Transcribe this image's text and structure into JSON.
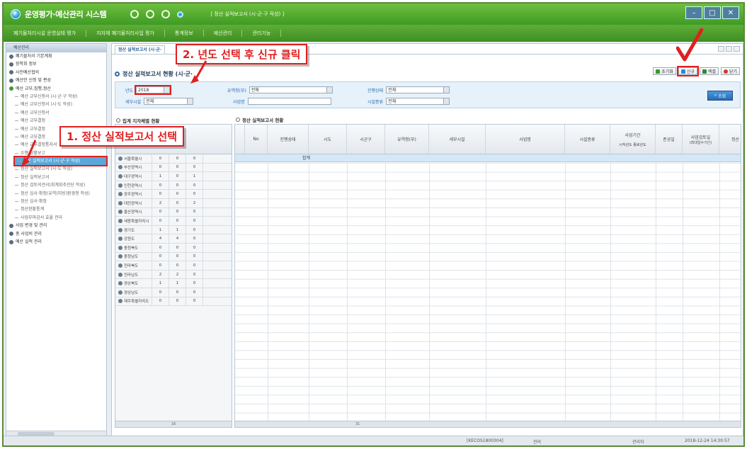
{
  "window": {
    "app_title": "운영평가·예산관리 시스템",
    "doc_title": "[ 정산 실적보고서 (시·군·구 작성) ]"
  },
  "menu": [
    "폐기물처리시설 운영실태 평가",
    "지자체 폐기물처리사업 평가",
    "통계정보",
    "예산관리",
    "관리기능"
  ],
  "sidebar": {
    "header": "예산관리",
    "items": [
      {
        "label": "폐기물처리 기본계획",
        "type": "top"
      },
      {
        "label": "장학회 정보",
        "type": "top"
      },
      {
        "label": "사전예산협의",
        "type": "top"
      },
      {
        "label": "예산안 신청 및 편성",
        "type": "top"
      },
      {
        "label": "예산 교부,집행,정산",
        "type": "top-open"
      },
      {
        "label": "예산 교부신청서 (시·군·구 작성)",
        "type": "child"
      },
      {
        "label": "예산 교부신청서 (시·도 작성)",
        "type": "child"
      },
      {
        "label": "예산 교부신청서",
        "type": "child"
      },
      {
        "label": "예산 교부결정",
        "type": "child"
      },
      {
        "label": "예산 교부결정",
        "type": "child"
      },
      {
        "label": "예산 교부결정",
        "type": "child"
      },
      {
        "label": "예산 교부결정통지서",
        "type": "child"
      },
      {
        "label": "수행 상황보고",
        "type": "child"
      },
      {
        "label": "정산 실적보고서 (시·군·구 작성)",
        "type": "selected"
      },
      {
        "label": "정산 실적보고서 (시·도 작성)",
        "type": "child"
      },
      {
        "label": "정산 실적보고서",
        "type": "child"
      },
      {
        "label": "정산 검토의견서(회계회추진단 작성)",
        "type": "child"
      },
      {
        "label": "정산 심사·확정(유역(지방)환경청 작성)",
        "type": "child"
      },
      {
        "label": "정산 심사·확정",
        "type": "child"
      },
      {
        "label": "정산현황통계",
        "type": "child"
      },
      {
        "label": "사업부마감서 효율 관리",
        "type": "child"
      },
      {
        "label": "사업 변경 및 관리",
        "type": "top"
      },
      {
        "label": "총 사업비 관리",
        "type": "top"
      },
      {
        "label": "예산 실적 관리",
        "type": "top"
      }
    ]
  },
  "main": {
    "tab_label": "정산 실적보고서 (시·군·",
    "page_title": "정산 실적보고서 현황 (시·군·",
    "buttons": {
      "reset": "초기화",
      "new": "신규",
      "excel": "엑셀",
      "close": "닫기"
    },
    "filters": {
      "year_label": "년도",
      "year_value": "2018",
      "office_label": "유역청(부)",
      "office_value": "전체",
      "status_label": "진행상태",
      "status_value": "전체",
      "facility_label": "세부시설",
      "facility_value": "전체",
      "project_label": "사업명",
      "project_value": "",
      "type_label": "시설종류",
      "type_value": "전체",
      "search_button": "조회"
    },
    "left_section_title": "집계 지자체별 현황",
    "right_section_title": "정산 실적보고서 현황",
    "regions": [
      {
        "name": "서울특별시",
        "a": "0",
        "b": "0",
        "c": "0"
      },
      {
        "name": "부산광역시",
        "a": "0",
        "b": "0",
        "c": "0"
      },
      {
        "name": "대구광역시",
        "a": "1",
        "b": "0",
        "c": "1"
      },
      {
        "name": "인천광역시",
        "a": "0",
        "b": "0",
        "c": "0"
      },
      {
        "name": "광주광역시",
        "a": "0",
        "b": "0",
        "c": "0"
      },
      {
        "name": "대전광역시",
        "a": "2",
        "b": "0",
        "c": "2"
      },
      {
        "name": "울산광역시",
        "a": "0",
        "b": "0",
        "c": "0"
      },
      {
        "name": "세종특별자치시",
        "a": "0",
        "b": "0",
        "c": "0"
      },
      {
        "name": "경기도",
        "a": "1",
        "b": "1",
        "c": "0"
      },
      {
        "name": "강원도",
        "a": "4",
        "b": "4",
        "c": "0"
      },
      {
        "name": "충청북도",
        "a": "0",
        "b": "0",
        "c": "0"
      },
      {
        "name": "충청남도",
        "a": "0",
        "b": "0",
        "c": "0"
      },
      {
        "name": "전라북도",
        "a": "0",
        "b": "0",
        "c": "0"
      },
      {
        "name": "전라남도",
        "a": "2",
        "b": "2",
        "c": "0"
      },
      {
        "name": "경상북도",
        "a": "1",
        "b": "1",
        "c": "0"
      },
      {
        "name": "경상남도",
        "a": "0",
        "b": "0",
        "c": "0"
      },
      {
        "name": "제주특별자치도",
        "a": "0",
        "b": "0",
        "c": "0"
      }
    ],
    "grid_columns": [
      "No",
      "진행상태",
      "시도",
      "시군구",
      "유역청(부)",
      "세부시설",
      "사업명",
      "시설종류",
      "사업기간",
      "준공일",
      "사업검토일",
      "정산"
    ],
    "grid_subcolumns": {
      "start": "시작년도",
      "end": "종료년도",
      "review": "(최대일수기간)"
    },
    "grid_total": "합계",
    "left_footer": "16",
    "right_footer": "31"
  },
  "status": {
    "code": "[KECOS1800304]",
    "name": "관리",
    "user": "관리자",
    "datetime": "2018-12-24 14:30:57"
  },
  "annotations": {
    "step1": "1. 정산 실적보고서 선택",
    "step2": "2. 년도 선택 후 신규 클릭"
  },
  "colors": {
    "accent_red": "#e02020",
    "brand_green": "#4fa82e",
    "selection_blue": "#5aa8d8"
  }
}
